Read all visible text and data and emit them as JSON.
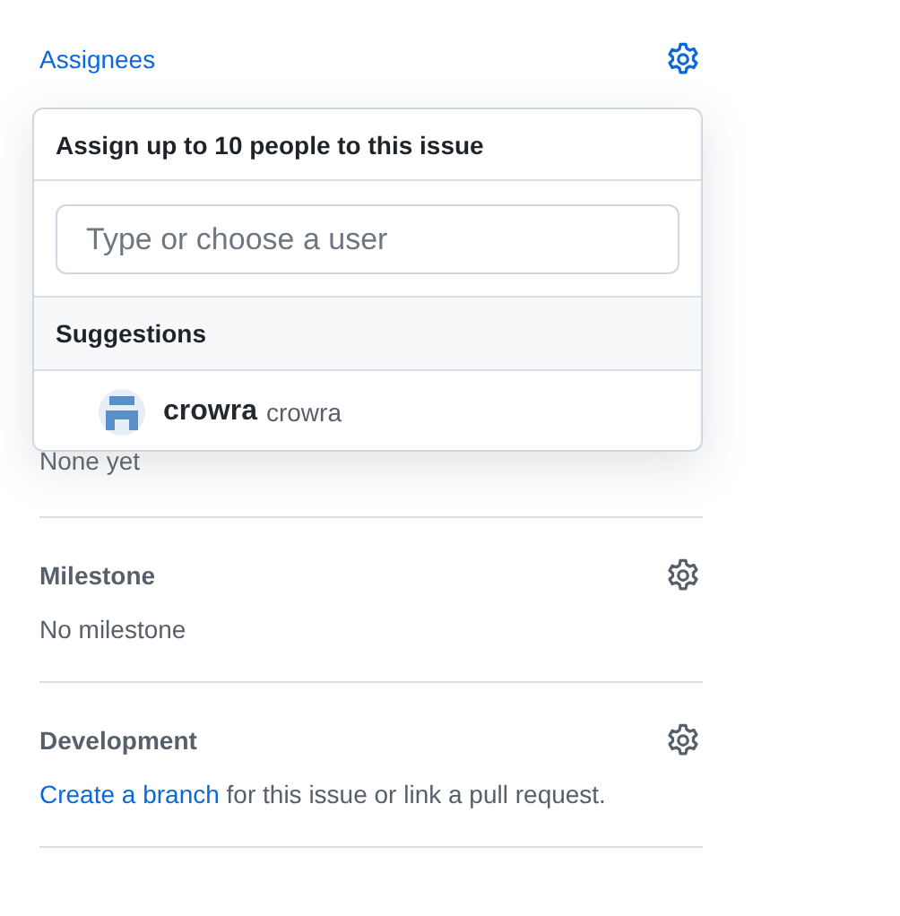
{
  "assignees": {
    "title": "Assignees",
    "value": "None yet"
  },
  "popup": {
    "title": "Assign up to 10 people to this issue",
    "search": {
      "placeholder": "Type or choose a user"
    },
    "section": "Suggestions",
    "users": [
      {
        "name": "crowra",
        "login": "crowra"
      }
    ]
  },
  "sections": [
    {
      "title": "Milestone",
      "kind": "plain",
      "text": "No milestone"
    },
    {
      "title": "Development",
      "kind": "link",
      "link": "Create a branch",
      "text": " for this issue or link a pull request."
    }
  ]
}
